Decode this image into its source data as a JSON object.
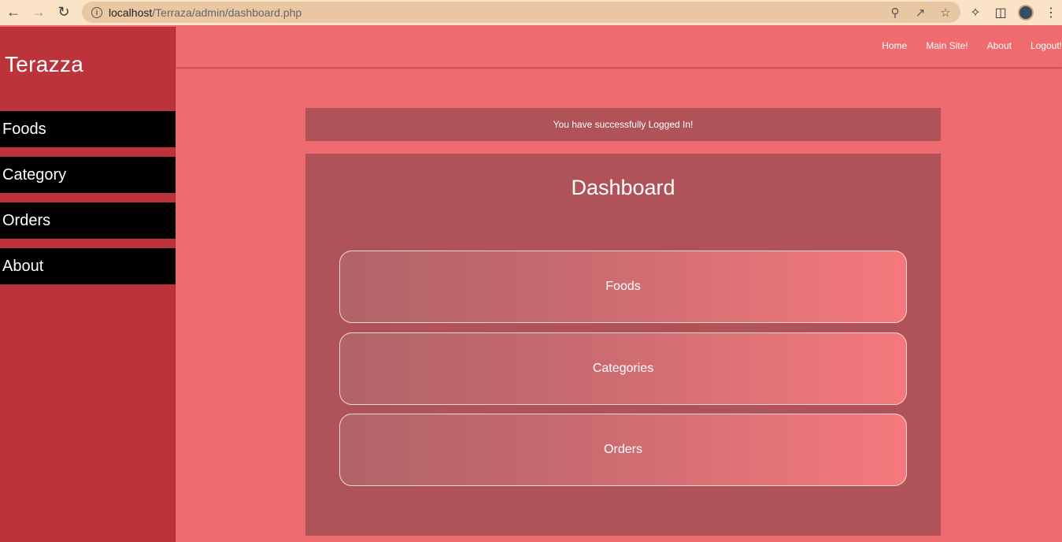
{
  "browser": {
    "url_host": "localhost",
    "url_path": "/Terraza/admin/dashboard.php",
    "icons": [
      "back-icon",
      "forward-icon",
      "reload-icon",
      "info-icon",
      "zoom-icon",
      "share-icon",
      "star-icon",
      "extensions-icon",
      "sidepanel-icon",
      "profile-avatar",
      "menu-icon"
    ]
  },
  "sidebar": {
    "brand": "Terazza",
    "items": [
      {
        "label": "Foods"
      },
      {
        "label": "Category"
      },
      {
        "label": "Orders"
      },
      {
        "label": "About"
      }
    ]
  },
  "topnav": {
    "links": [
      {
        "label": "Home"
      },
      {
        "label": "Main Site!"
      },
      {
        "label": "About"
      },
      {
        "label": "Logout!"
      }
    ]
  },
  "main": {
    "alert": "You have successfully Logged In!",
    "title": "Dashboard",
    "cards": [
      {
        "label": "Foods"
      },
      {
        "label": "Categories"
      },
      {
        "label": "Orders"
      }
    ]
  },
  "colors": {
    "page_bg": "#ef6b6f",
    "sidebar_bg": "#bd333b",
    "panel_bg": "#b05358",
    "menu_item_bg": "#000000"
  }
}
